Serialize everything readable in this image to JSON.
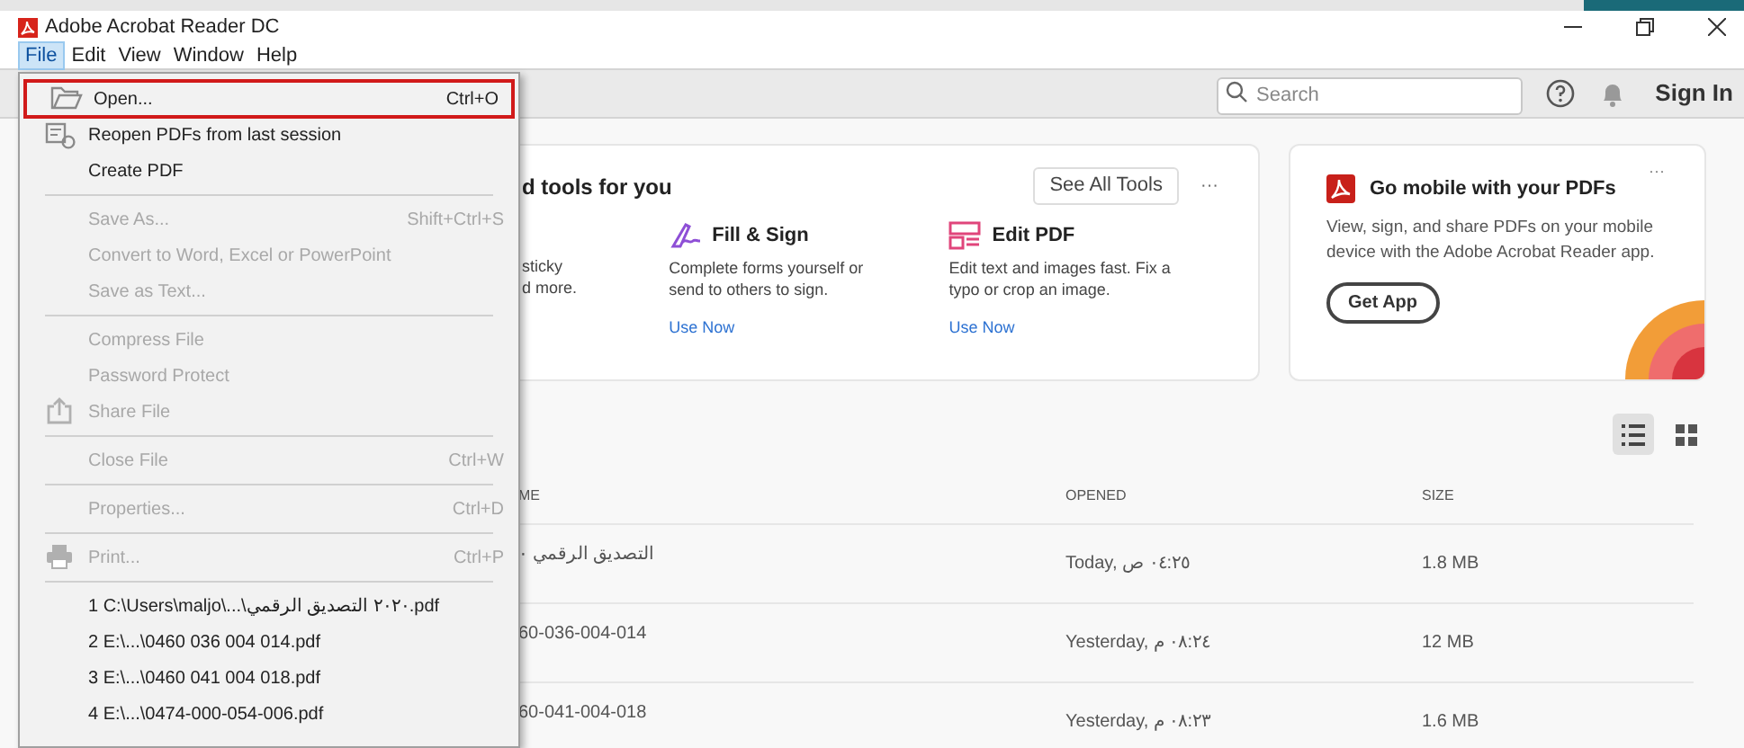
{
  "window": {
    "title": "Adobe Acrobat Reader DC"
  },
  "menu_bar": [
    {
      "label": "File",
      "selected": true
    },
    {
      "label": "Edit",
      "selected": false
    },
    {
      "label": "View",
      "selected": false
    },
    {
      "label": "Window",
      "selected": false
    },
    {
      "label": "Help",
      "selected": false
    }
  ],
  "file_menu": [
    {
      "kind": "command",
      "label": "Open...",
      "shortcut": "Ctrl+O",
      "disabled": false,
      "highlighted": true
    },
    {
      "kind": "command",
      "label": "Reopen PDFs from last session",
      "disabled": false,
      "highlighted": false
    },
    {
      "kind": "command",
      "label": "Create PDF",
      "disabled": false,
      "highlighted": false
    },
    {
      "kind": "separator"
    },
    {
      "kind": "command",
      "label": "Save As...",
      "shortcut": "Shift+Ctrl+S",
      "disabled": true,
      "highlighted": false
    },
    {
      "kind": "command",
      "label": "Convert to Word, Excel or PowerPoint",
      "disabled": true,
      "highlighted": false
    },
    {
      "kind": "command",
      "label": "Save as Text...",
      "disabled": true,
      "highlighted": false
    },
    {
      "kind": "separator"
    },
    {
      "kind": "command",
      "label": "Compress File",
      "disabled": true,
      "highlighted": false
    },
    {
      "kind": "command",
      "label": "Password Protect",
      "disabled": true,
      "highlighted": false
    },
    {
      "kind": "command",
      "label": "Share File",
      "disabled": true,
      "highlighted": false
    },
    {
      "kind": "separator"
    },
    {
      "kind": "command",
      "label": "Close File",
      "shortcut": "Ctrl+W",
      "disabled": true,
      "highlighted": false
    },
    {
      "kind": "separator"
    },
    {
      "kind": "command",
      "label": "Properties...",
      "shortcut": "Ctrl+D",
      "disabled": true,
      "highlighted": false
    },
    {
      "kind": "separator"
    },
    {
      "kind": "command",
      "label": "Print...",
      "shortcut": "Ctrl+P",
      "disabled": true,
      "highlighted": false
    },
    {
      "kind": "separator"
    },
    {
      "kind": "recent",
      "label": "1 C:\\Users\\maljo\\...\\٢٠٢٠ التصديق الرقمي.pdf"
    },
    {
      "kind": "recent",
      "label": "2 E:\\...\\0460 036 004 014.pdf"
    },
    {
      "kind": "recent",
      "label": "3 E:\\...\\0460 041 004 018.pdf"
    },
    {
      "kind": "recent",
      "label": "4 E:\\...\\0474-000-054-006.pdf"
    }
  ],
  "toolbar": {
    "search": {
      "placeholder": "Search"
    },
    "sign_in": "Sign In"
  },
  "tools_card": {
    "heading": "d tools for you",
    "see_all": "See All Tools",
    "more": "···",
    "tools": [
      {
        "kind": "partial",
        "description": [
          "sticky",
          "d more."
        ]
      },
      {
        "kind": "tool",
        "name": "Fill & Sign",
        "description": [
          "Complete forms yourself or",
          "send to others to sign."
        ],
        "link": "Use Now"
      },
      {
        "kind": "tool",
        "name": "Edit PDF",
        "description": [
          "Edit text and images fast. Fix a",
          "typo or crop an image."
        ],
        "link": "Use Now"
      }
    ]
  },
  "mobile_card": {
    "title": "Go mobile with your PDFs",
    "more": "···",
    "text": "View, sign, and share PDFs on your mobile device with the Adobe Acrobat Reader app.",
    "button": "Get App"
  },
  "view_toggle": [
    {
      "kind": "list",
      "selected": true
    },
    {
      "kind": "grid",
      "selected": false
    }
  ],
  "files_table": {
    "columns": [
      "ME",
      "OPENED",
      "SIZE"
    ],
    "rows": [
      [
        "التصديق الرقمي ٠",
        "Today, ٠٤:٢٥ ص",
        "1.8 MB"
      ],
      [
        "60-036-004-014",
        "Yesterday, ٠٨:٢٤ م",
        "12 MB"
      ],
      [
        "60-041-004-018",
        "Yesterday, ٠٨:٢٣ م",
        "1.6 MB"
      ]
    ]
  }
}
